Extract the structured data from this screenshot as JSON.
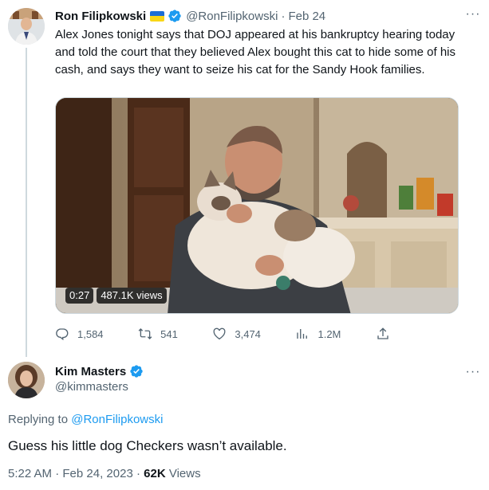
{
  "tweet": {
    "author_name": "Ron Filipkowski",
    "author_handle": "@RonFilipkowski",
    "separator": "·",
    "date": "Feb 24",
    "more": "···",
    "text": "Alex Jones tonight says that DOJ appeared at his bankruptcy hearing today and told the court that they believed Alex bought this cat to hide some of his cash, and says they want to seize his cat for the Sandy Hook families.",
    "video": {
      "duration": "0:27",
      "views": "487.1K views"
    },
    "stats": {
      "replies": "1,584",
      "retweets": "541",
      "likes": "3,474",
      "views": "1.2M"
    },
    "flag_colors": {
      "top": "#1c6ed5",
      "bottom": "#f9d616"
    },
    "verified_color": "#1d9bf0"
  },
  "reply": {
    "author_name": "Kim Masters",
    "author_handle": "@kimmasters",
    "more": "···",
    "replying_to_prefix": "Replying to ",
    "replying_to_handle": "@RonFilipkowski",
    "text": "Guess his little dog Checkers wasn’t available.",
    "time": "5:22 AM",
    "separator": "·",
    "date": "Feb 24, 2023",
    "views_count": "62K",
    "views_label": " Views"
  },
  "icons": {
    "reply": "reply-icon",
    "retweet": "retweet-icon",
    "like": "heart-icon",
    "views": "bar-chart-icon",
    "share": "share-icon",
    "verified": "verified-badge-icon",
    "more": "more-icon"
  },
  "colors": {
    "link": "#1d9bf0",
    "muted": "#536471",
    "text": "#0f1419",
    "line": "#cfd9de"
  }
}
